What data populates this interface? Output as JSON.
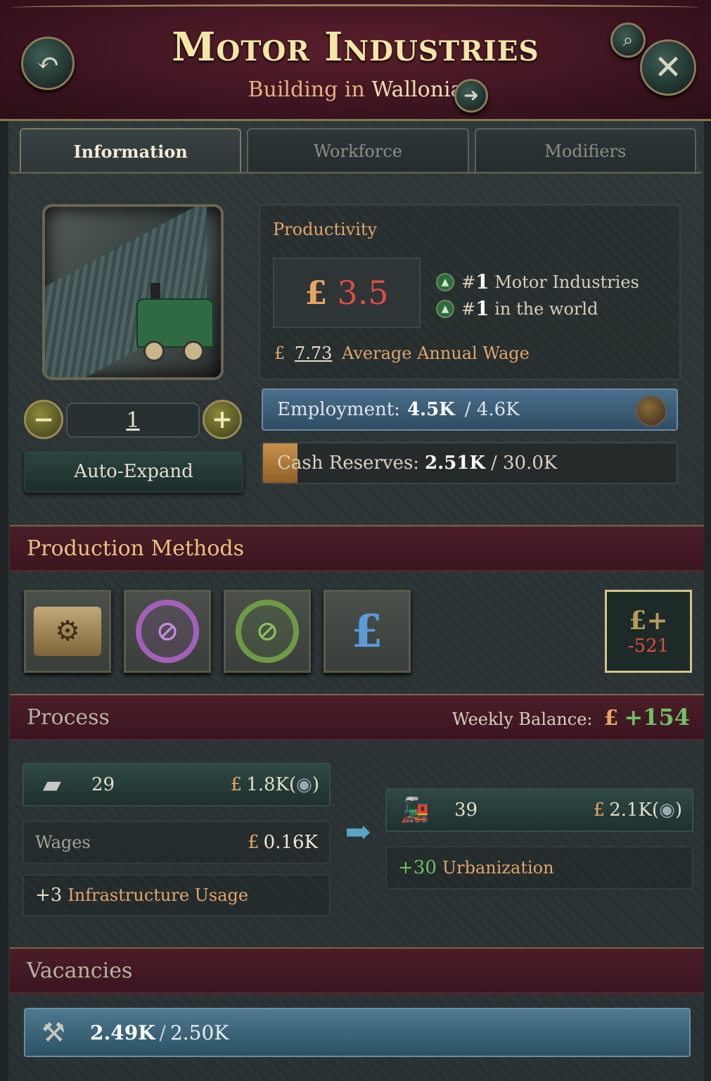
{
  "header": {
    "title": "Motor Industries",
    "subtitle_prefix": "Building in",
    "location": "Wallonia",
    "back_icon": "↶",
    "close_icon": "✕",
    "search_icon": "⌕",
    "goto_icon": "➜"
  },
  "tabs": [
    {
      "label": "Information",
      "active": true
    },
    {
      "label": "Workforce",
      "active": false
    },
    {
      "label": "Modifiers",
      "active": false
    }
  ],
  "building": {
    "level": "1",
    "minus_icon": "−",
    "plus_icon": "+",
    "auto_expand_label": "Auto-Expand"
  },
  "productivity": {
    "label": "Productivity",
    "currency": "£",
    "value": "3.5",
    "rank1_hash": "#",
    "rank1_num": "1",
    "rank1_text": "Motor Industries",
    "rank2_hash": "#",
    "rank2_num": "1",
    "rank2_text": "in the world",
    "wage_amount": "7.73",
    "wage_label": "Average Annual Wage"
  },
  "employment": {
    "label": "Employment:",
    "current": "4.5K",
    "max": "/ 4.6K",
    "fill_fraction": 0.98
  },
  "cash": {
    "label": "Cash Reserves:",
    "current": "2.51K",
    "max": "/ 30.0K",
    "fill_fraction": 0.084
  },
  "production_methods": {
    "title": "Production Methods",
    "owner_value": "-521",
    "owner_icon": "£+"
  },
  "process": {
    "title": "Process",
    "balance_label": "Weekly Balance:",
    "balance_value": "+154",
    "input": {
      "qty": "29",
      "price": "1.8K",
      "paren_open": "(",
      "paren_close": ")"
    },
    "wages_label": "Wages",
    "wages_amount": "0.16K",
    "infra_num": "+3",
    "infra_label": "Infrastructure Usage",
    "output": {
      "qty": "39",
      "price": "2.1K",
      "paren_open": "(",
      "paren_close": ")"
    },
    "urban_num": "+30",
    "urban_label": "Urbanization"
  },
  "vacancies": {
    "title": "Vacancies",
    "current": "2.49K",
    "max": "2.50K",
    "separator": "/"
  },
  "colors": {
    "header_bg": "#3c1420",
    "accent_gold": "#f4e6a4",
    "negative": "#e24b3f",
    "positive": "#6ec063",
    "bar_blue": "#4a6f8a"
  }
}
